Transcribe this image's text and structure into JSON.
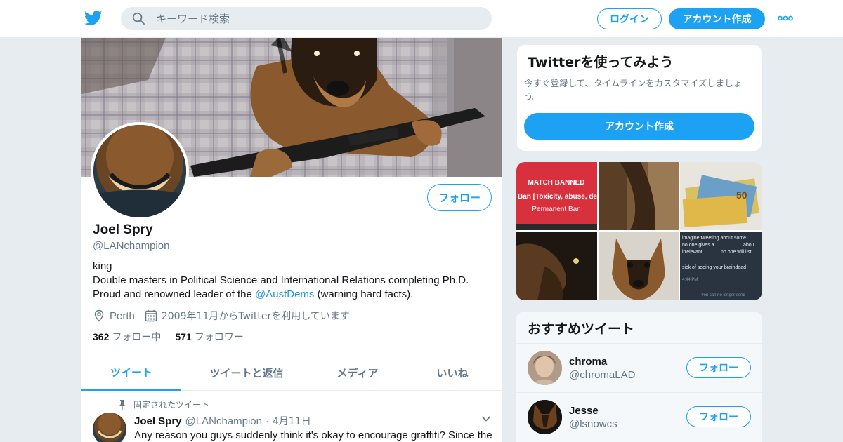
{
  "nav": {
    "search_placeholder": "キーワード検索",
    "login_label": "ログイン",
    "signup_label": "アカウント作成",
    "icons": [
      "twitter-bird-icon",
      "search-icon",
      "more-icon"
    ],
    "brand_color": "#1da1f2"
  },
  "profile": {
    "name": "Joel Spry",
    "handle": "@LANchampion",
    "follow_label": "フォロー",
    "bio_line1": "king",
    "bio_line2_before": "Double masters in Political Science and International Relations completing Ph.D. Proud and renowned leader of the ",
    "bio_link": "@AustDems",
    "bio_line2_after": " (warning hard facts).",
    "location": "Perth",
    "joined": "2009年11月からTwitterを利用しています",
    "following_count": "362",
    "following_label": "フォロー中",
    "followers_count": "571",
    "followers_label": "フォロワー"
  },
  "tabs": [
    {
      "label": "ツイート",
      "active": true
    },
    {
      "label": "ツイートと返信",
      "active": false
    },
    {
      "label": "メディア",
      "active": false
    },
    {
      "label": "いいね",
      "active": false
    }
  ],
  "pinned_tweet": {
    "pinned_label": "固定されたツイート",
    "author_name": "Joel Spry",
    "author_handle": "@LANchampion",
    "separator": "·",
    "date": "4月11日",
    "text": "Any reason you guys suddenly think it's okay to encourage graffiti? Since the"
  },
  "signup_card": {
    "title": "Twitterを使ってみよう",
    "description": "今すぐ登録して、タイムラインをカスタマイズしましょう。",
    "button_label": "アカウント作成"
  },
  "media_grid": {
    "cell1_text1": "MATCH BANNED",
    "cell1_text2": "Ban [Toxicity, abuse, de",
    "cell1_text3": "Permanent Ban",
    "cell3_note": "50",
    "cell6_line1": "imagine tweeting about some",
    "cell6_line2": "no one gives a",
    "cell6_line3": "abou",
    "cell6_line4": "irrelevant",
    "cell6_line5": "no one will list",
    "cell6_line6": "sick of seeing your braindead",
    "cell6_time": "4:44 PM",
    "cell6_footer": "You can no longer send"
  },
  "suggestions": {
    "title": "おすすめツイート",
    "follow_label": "フォロー",
    "items": [
      {
        "name": "chroma",
        "handle": "@chromaLAD"
      },
      {
        "name": "Jesse",
        "handle": "@lsnowcs"
      }
    ]
  }
}
